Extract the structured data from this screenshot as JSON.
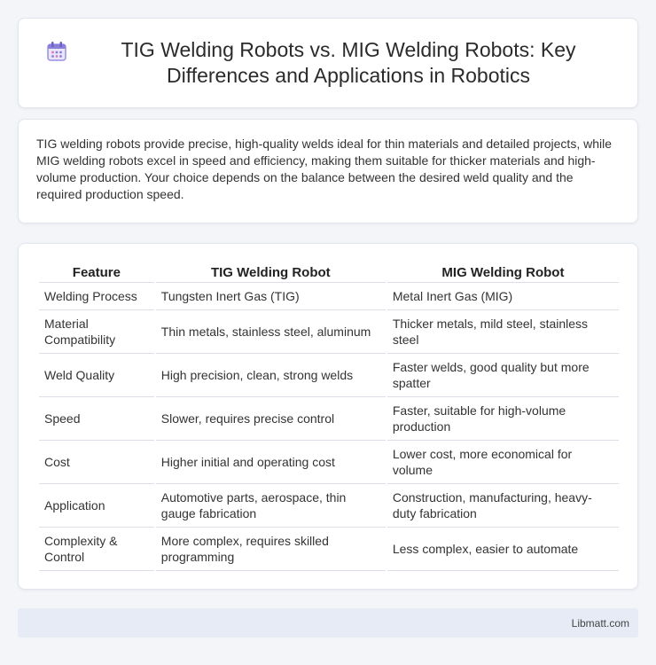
{
  "header": {
    "icon": "calendar-icon",
    "title": "TIG Welding Robots vs. MIG Welding Robots: Key Differences and Applications in Robotics"
  },
  "summary": "TIG welding robots provide precise, high-quality welds ideal for thin materials and detailed projects, while MIG welding robots excel in speed and efficiency, making them suitable for thicker materials and high-volume production. Your choice depends on the balance between the desired weld quality and the required production speed.",
  "table": {
    "headers": [
      "Feature",
      "TIG Welding Robot",
      "MIG Welding Robot"
    ],
    "rows": [
      [
        "Welding Process",
        "Tungsten Inert Gas (TIG)",
        "Metal Inert Gas (MIG)"
      ],
      [
        "Material Compatibility",
        "Thin metals, stainless steel, aluminum",
        "Thicker metals, mild steel, stainless steel"
      ],
      [
        "Weld Quality",
        "High precision, clean, strong welds",
        "Faster welds, good quality but more spatter"
      ],
      [
        "Speed",
        "Slower, requires precise control",
        "Faster, suitable for high-volume production"
      ],
      [
        "Cost",
        "Higher initial and operating cost",
        "Lower cost, more economical for volume"
      ],
      [
        "Application",
        "Automotive parts, aerospace, thin gauge fabrication",
        "Construction, manufacturing, heavy-duty fabrication"
      ],
      [
        "Complexity & Control",
        "More complex, requires skilled programming",
        "Less complex, easier to automate"
      ]
    ]
  },
  "footer": {
    "text": "Libmatt.com"
  },
  "colors": {
    "background": "#f3f5f9",
    "footer": "#e6ebf5",
    "icon_accent": "#8a7fd8"
  }
}
